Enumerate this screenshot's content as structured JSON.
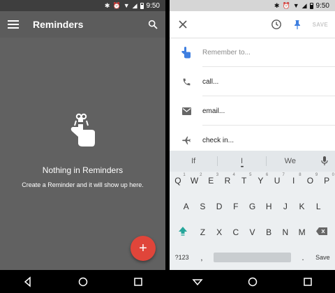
{
  "status": {
    "time": "9:50"
  },
  "left": {
    "appbar": {
      "title": "Reminders"
    },
    "empty": {
      "heading": "Nothing in Reminders",
      "message": "Create a Reminder and it will show up here."
    },
    "fab": {
      "label": "+"
    }
  },
  "right": {
    "topbar": {
      "save_label": "SAVE"
    },
    "input": {
      "placeholder": "Remember to..."
    },
    "suggestions": [
      {
        "label": "call...",
        "icon": "phone-icon"
      },
      {
        "label": "email...",
        "icon": "email-icon"
      },
      {
        "label": "check in...",
        "icon": "airplane-icon"
      }
    ],
    "keyboard": {
      "suggestions": [
        "If",
        "I",
        "We"
      ],
      "row1": [
        "Q",
        "W",
        "E",
        "R",
        "T",
        "Y",
        "U",
        "I",
        "O",
        "P"
      ],
      "row1_hints": [
        "1",
        "2",
        "3",
        "4",
        "5",
        "6",
        "7",
        "8",
        "9",
        "0"
      ],
      "row2": [
        "A",
        "S",
        "D",
        "F",
        "G",
        "H",
        "J",
        "K",
        "L"
      ],
      "row3": [
        "Z",
        "X",
        "C",
        "V",
        "B",
        "N",
        "M"
      ],
      "symbols_label": "?123",
      "comma": ",",
      "period": ".",
      "enter_label": "Save"
    }
  },
  "colors": {
    "fab": "#e0453a",
    "accent_blue": "#3f7fe0",
    "shift_teal": "#26a69a"
  }
}
